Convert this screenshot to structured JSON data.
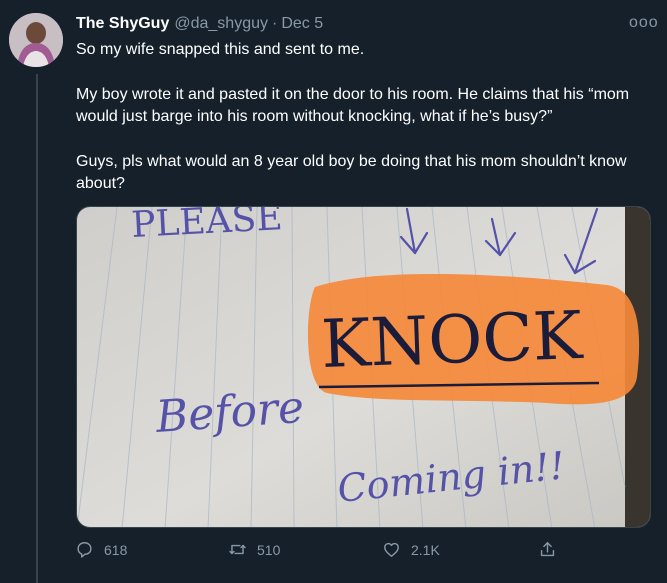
{
  "tweet": {
    "display_name": "The ShyGuy",
    "handle": "@da_shyguy",
    "separator": "·",
    "date": "Dec 5",
    "more": "ooo",
    "text_1": "So my wife snapped this and sent to me.",
    "text_2": "My boy wrote it and pasted it on the door to his room. He claims that his “mom would just barge into his room without knocking, what if he’s busy?”",
    "text_3": "Guys, pls what would an 8 year old boy be doing that his mom shouldn’t know about?"
  },
  "image": {
    "line_1": "PLEASE",
    "line_2": "KNOCK",
    "line_3": "Before",
    "line_4": "Coming in!!"
  },
  "actions": {
    "reply_count": "618",
    "retweet_count": "510",
    "like_count": "2.1K"
  },
  "colors": {
    "background": "#15202b",
    "secondary_text": "#8899a6",
    "highlighter": "#f5893a",
    "ink": "#5552a8"
  },
  "icons": [
    "reply-icon",
    "retweet-icon",
    "like-icon",
    "share-icon",
    "more-icon"
  ]
}
